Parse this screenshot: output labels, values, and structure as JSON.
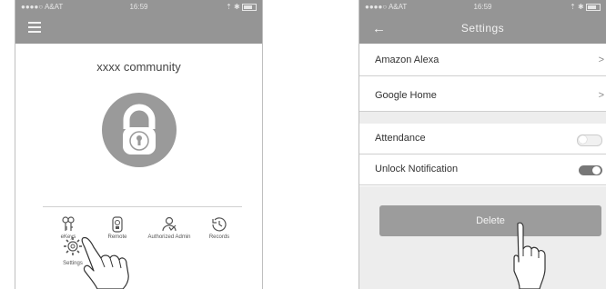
{
  "left_screen": {
    "status": {
      "carrier": "●●●●○ A&AT",
      "time": "16:59",
      "right": "⇡ ✱"
    },
    "community": "xxxx community",
    "functions": [
      {
        "label": "eKeys",
        "icon": "keys-icon"
      },
      {
        "label": "Remote",
        "icon": "remote-icon"
      },
      {
        "label": "Authorized Admin",
        "icon": "admin-icon"
      },
      {
        "label": "Records",
        "icon": "records-icon"
      }
    ],
    "settings_label": "Settings"
  },
  "right_screen": {
    "status": {
      "carrier": "●●●●○ A&AT",
      "time": "16:59",
      "right": "⇡ ✱"
    },
    "title": "Settings",
    "rows": [
      {
        "label": "Amazon Alexa",
        "chevron": ">"
      },
      {
        "label": "Google Home",
        "chevron": ">"
      }
    ],
    "toggles": [
      {
        "label": "Attendance",
        "state": "off"
      },
      {
        "label": "Unlock Notification",
        "state": "on"
      }
    ],
    "delete_label": "Delete"
  },
  "colors": {
    "bar": "#959595",
    "lock": "#9a9a9a",
    "button": "#9c9c9c"
  }
}
